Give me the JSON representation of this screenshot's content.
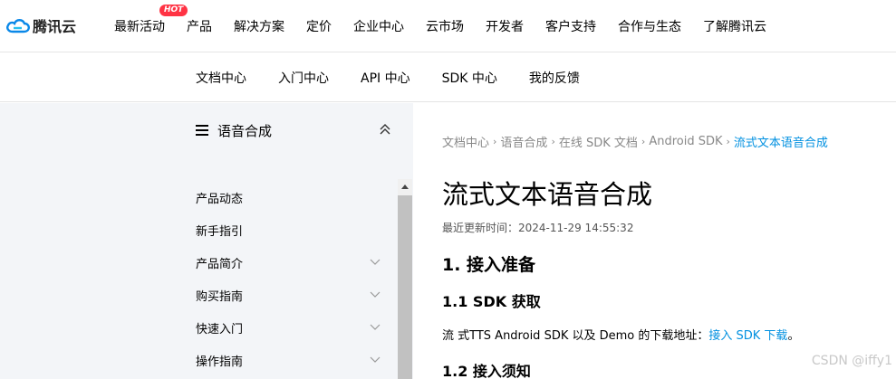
{
  "brand": {
    "name": "腾讯云",
    "logo_icon": "tencent-cloud-logo"
  },
  "top_nav": {
    "items": [
      "最新活动",
      "产品",
      "解决方案",
      "定价",
      "企业中心",
      "云市场",
      "开发者",
      "客户支持",
      "合作与生态",
      "了解腾讯云"
    ],
    "hot_badge": "HOT"
  },
  "sub_nav": {
    "items": [
      "文档中心",
      "入门中心",
      "API 中心",
      "SDK 中心",
      "我的反馈"
    ]
  },
  "sidebar": {
    "title": "语音合成",
    "items": [
      {
        "label": "产品动态",
        "has_children": false
      },
      {
        "label": "新手指引",
        "has_children": false
      },
      {
        "label": "产品简介",
        "has_children": true
      },
      {
        "label": "购买指南",
        "has_children": true
      },
      {
        "label": "快速入门",
        "has_children": true
      },
      {
        "label": "操作指南",
        "has_children": true
      }
    ]
  },
  "breadcrumb": [
    "文档中心",
    "语音合成",
    "在线 SDK 文档",
    "Android SDK",
    "流式文本语音合成"
  ],
  "article": {
    "title": "流式文本语音合成",
    "update_label": "最近更新时间：2024-11-29 14:55:32",
    "h2": "1. 接入准备",
    "h3_1": "1.1 SDK 获取",
    "para_text": "流 式TTS Android SDK 以及 Demo 的下载地址：",
    "para_link": "接入 SDK 下载",
    "para_end": "。",
    "h3_2": "1.2 接入须知"
  },
  "watermark": "CSDN @iffy1",
  "colors": {
    "link": "#0090e0",
    "sidebar_bg": "#f3f5f8",
    "hot_badge": "#ff3344"
  }
}
